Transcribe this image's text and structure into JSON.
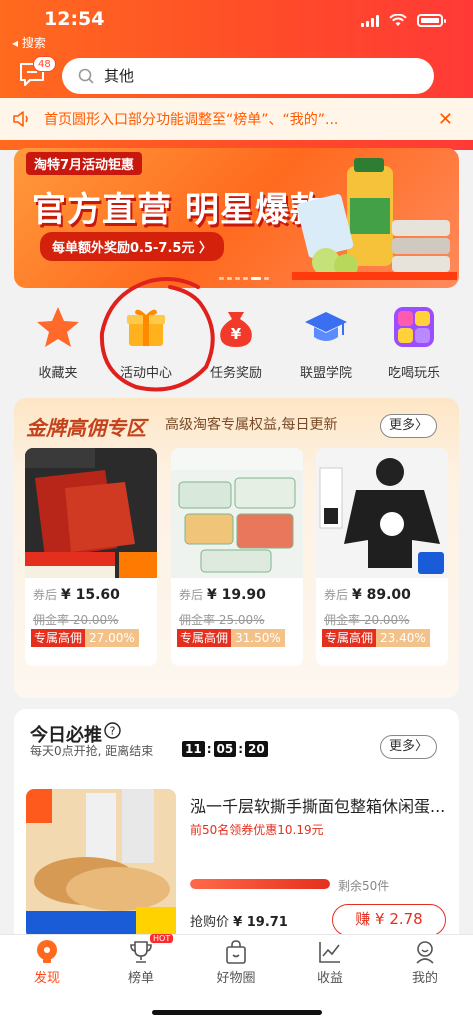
{
  "status": {
    "time": "12:54",
    "back_label": "◂ 搜索"
  },
  "header": {
    "message_count": "48",
    "search_placeholder": "其他"
  },
  "notice": {
    "text": "首页圆形入口部分功能调整至“榜单”、“我的”..."
  },
  "banner": {
    "tag": "淘特7月活动钜惠",
    "title": "官方直营 明星爆款",
    "subtitle": "每单额外奖励0.5-7.5元 〉"
  },
  "quick_menu": [
    {
      "label": "收藏夹",
      "icon": "star-icon"
    },
    {
      "label": "活动中心",
      "icon": "gift-icon"
    },
    {
      "label": "任务奖励",
      "icon": "money-bag-icon"
    },
    {
      "label": "联盟学院",
      "icon": "graduation-cap-icon"
    },
    {
      "label": "吃喝玩乐",
      "icon": "apps-icon"
    }
  ],
  "gold_section": {
    "title": "金牌高佣专区",
    "subtitle": "高级淘客专属权益,每日更新",
    "more": "更多〉",
    "products": [
      {
        "price_label": "券后",
        "price": "¥ 15.60",
        "old_rate": "佣金率 20.00%",
        "rate_label": "专属高佣",
        "rate": "27.00%"
      },
      {
        "price_label": "券后",
        "price": "¥ 19.90",
        "old_rate": "佣金率 25.00%",
        "rate_label": "专属高佣",
        "rate": "31.50%"
      },
      {
        "price_label": "券后",
        "price": "¥ 89.00",
        "old_rate": "佣金率 20.00%",
        "rate_label": "专属高佣",
        "rate": "23.40%"
      }
    ]
  },
  "today": {
    "title": "今日必推",
    "subtitle": "每天0点开抢, 距离结束",
    "countdown": [
      "11",
      "05",
      "20"
    ],
    "more": "更多〉",
    "deal": {
      "title": "泓一千层软撕手撕面包整箱休闲蛋...",
      "coupon": "前50名领券优惠10.19元",
      "remaining": "剩余50件",
      "price_label": "抢购价",
      "price": "¥ 19.71",
      "earn": "赚 ¥ 2.78"
    }
  },
  "tabbar": [
    {
      "label": "发现",
      "icon": "discover-icon",
      "active": true
    },
    {
      "label": "榜单",
      "icon": "trophy-icon",
      "badge": "HOT"
    },
    {
      "label": "好物圈",
      "icon": "shopping-bag-icon"
    },
    {
      "label": "收益",
      "icon": "income-chart-icon"
    },
    {
      "label": "我的",
      "icon": "profile-icon"
    }
  ],
  "colors": {
    "brand": "#ff4a2a",
    "accent_red": "#e52f1e",
    "gold": "#c4431c"
  }
}
